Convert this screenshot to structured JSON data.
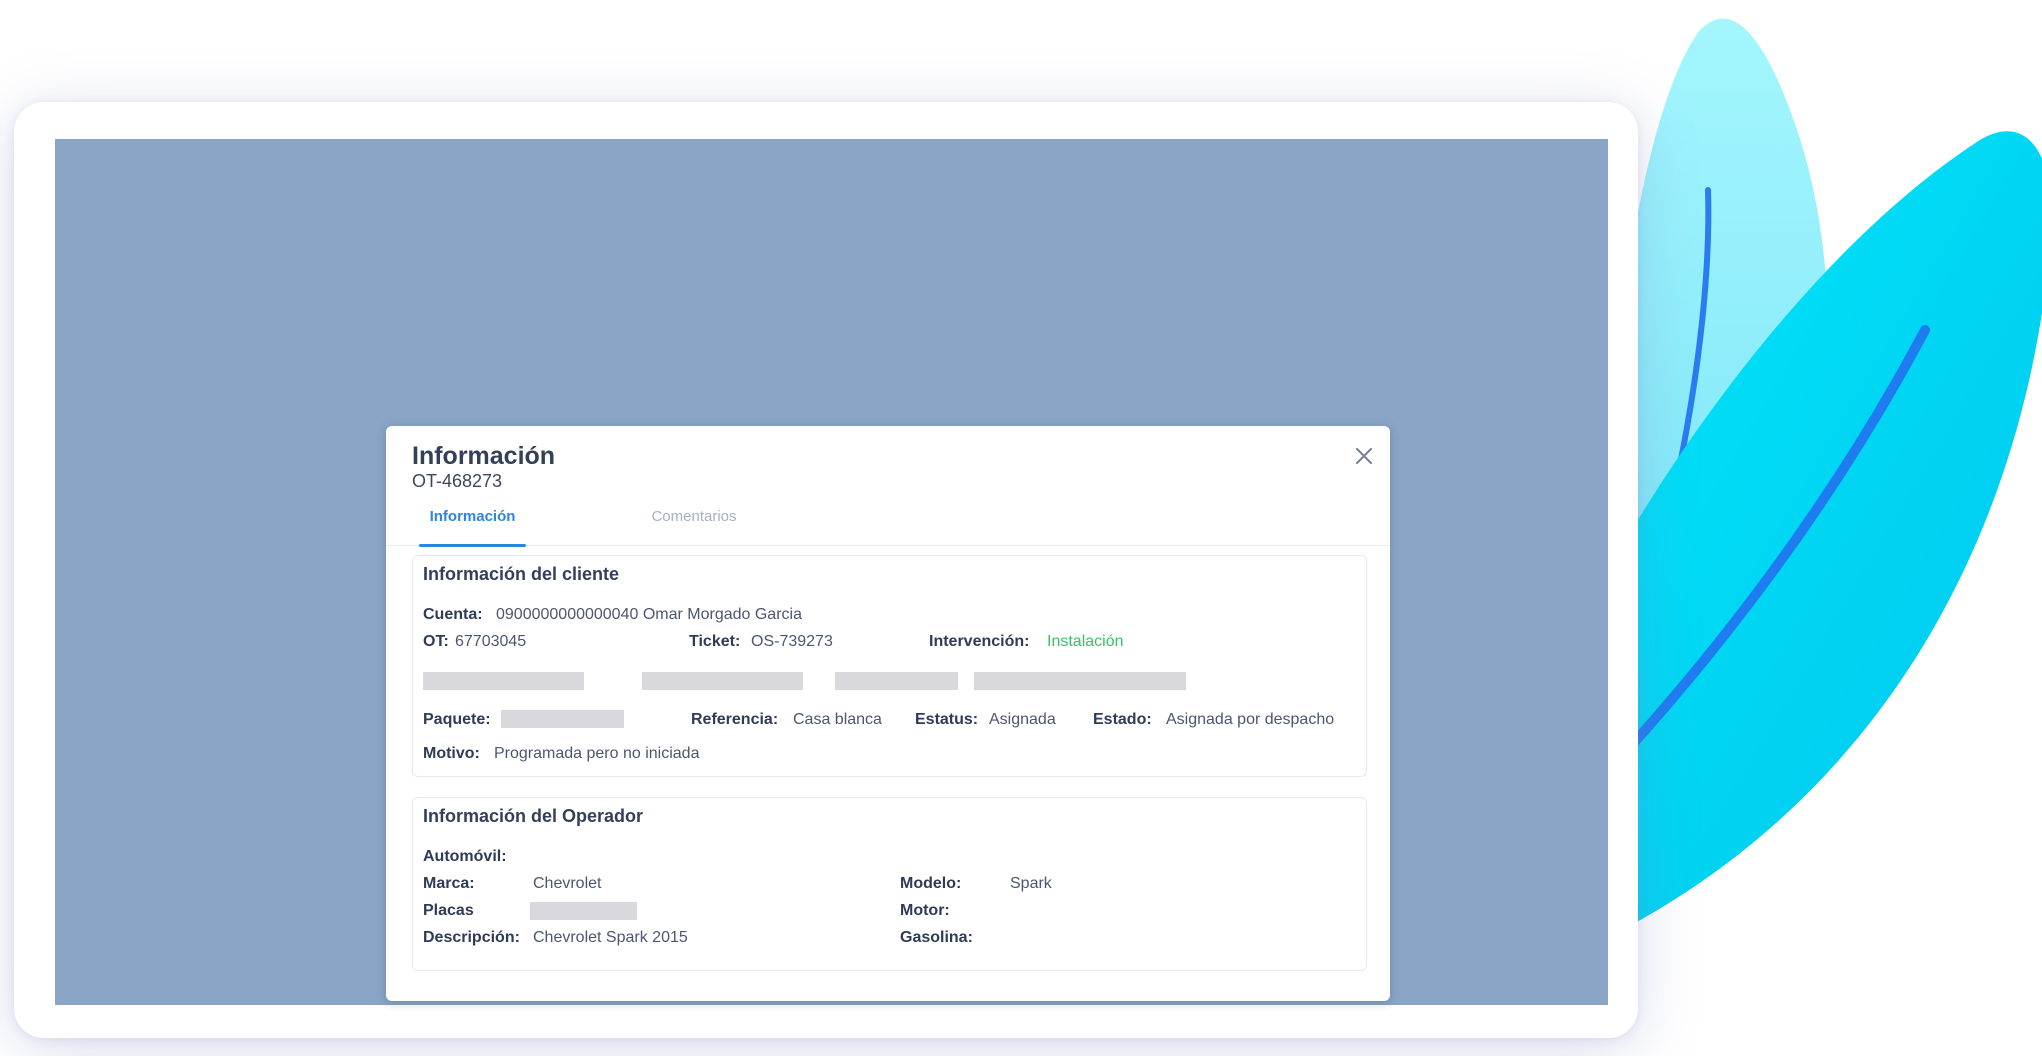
{
  "modal": {
    "title": "Información",
    "subtitle": "OT-468273",
    "close_icon": "close-icon"
  },
  "tabs": [
    {
      "label": "Información",
      "active": true
    },
    {
      "label": "Comentarios",
      "active": false
    }
  ],
  "client_section": {
    "title": "Información del cliente",
    "cuenta_label": "Cuenta:",
    "cuenta_value": "0900000000000040 Omar Morgado Garcia",
    "ot_label": "OT:",
    "ot_value": "67703045",
    "ticket_label": "Ticket:",
    "ticket_value": "OS-739273",
    "intervencion_label": "Intervención:",
    "intervencion_value": "Instalación",
    "paquete_label": "Paquete:",
    "referencia_label": "Referencia:",
    "referencia_value": "Casa blanca",
    "estatus_label": "Estatus:",
    "estatus_value": "Asignada",
    "estado_label": "Estado:",
    "estado_value": "Asignada por despacho",
    "motivo_label": "Motivo:",
    "motivo_value": "Programada pero no iniciada"
  },
  "operator_section": {
    "title": "Información del Operador",
    "automovil_label": "Automóvil:",
    "marca_label": "Marca:",
    "marca_value": "Chevrolet",
    "modelo_label": "Modelo:",
    "modelo_value": "Spark",
    "placas_label": "Placas",
    "motor_label": "Motor:",
    "descripcion_label": "Descripción:",
    "descripcion_value": "Chevrolet Spark 2015",
    "gasolina_label": "Gasolina:"
  },
  "colors": {
    "accent": "#2c86e0",
    "success": "#36c26a",
    "backdrop": "#8aa5c5",
    "leaf_light": "#8ff0fb",
    "leaf_main": "#00d9f5",
    "leaf_stroke": "#1f7cf0"
  }
}
